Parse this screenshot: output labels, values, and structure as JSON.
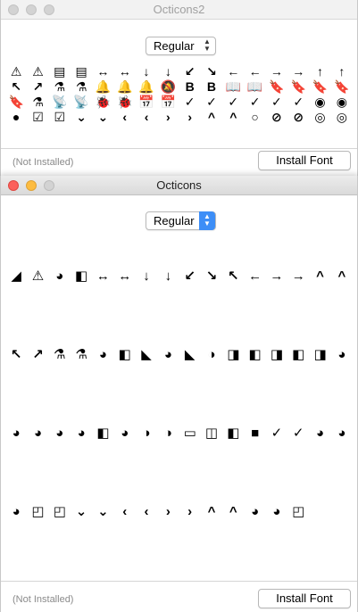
{
  "back_window": {
    "title": "Octicons2",
    "style_select": "Regular",
    "glyphs": [
      "⚠",
      "⚠",
      "▤",
      "▤",
      "↔",
      "↔",
      "↓",
      "↓",
      "↙",
      "↘",
      "←",
      "←",
      "→",
      "→",
      "↑",
      "↑",
      "↖",
      "↗",
      "⚗",
      "⚗",
      "🔔",
      "🔔",
      "🔔",
      "🔕",
      "B",
      "B",
      "📖",
      "📖",
      "🔖",
      "🔖",
      "🔖",
      "🔖",
      "🔖",
      "⚗",
      "📡",
      "📡",
      "🐞",
      "🐞",
      "📅",
      "📅",
      "✓",
      "✓",
      "✓",
      "✓",
      "✓",
      "✓",
      "◉",
      "◉",
      "●",
      "☑",
      "☑",
      "⌄",
      "⌄",
      "‹",
      "‹",
      "›",
      "›",
      "^",
      "^",
      "○",
      "⊘",
      "⊘",
      "◎",
      "◎"
    ],
    "status": "(Not Installed)",
    "install_label": "Install Font"
  },
  "front_window": {
    "title": "Octicons",
    "style_select": "Regular",
    "glyphs": [
      "◢",
      "⚠",
      "◕",
      "◧",
      "↔",
      "↔",
      "↓",
      "↓",
      "↙",
      "↘",
      "↖",
      "←",
      "→",
      "→",
      "^",
      "^",
      "↖",
      "↗",
      "⚗",
      "⚗",
      "◕",
      "◧",
      "◣",
      "◕",
      "◣",
      "◑",
      "◨",
      "◧",
      "◨",
      "◧",
      "◨",
      "◕",
      "◕",
      "◕",
      "◕",
      "◕",
      "◧",
      "◕",
      "◑",
      "◑",
      "▭",
      "◫",
      "◧",
      "■",
      "✓",
      "✓",
      "◕",
      "◕",
      "◕",
      "◰",
      "◰",
      "⌄",
      "⌄",
      "‹",
      "‹",
      "›",
      "›",
      "^",
      "^",
      "◕",
      "◕",
      "◰"
    ],
    "status": "(Not Installed)",
    "install_label": "Install Font"
  },
  "colors": {
    "close": "#fc605b",
    "minimize": "#fdbc40",
    "select_active": "#3d8ef7"
  }
}
